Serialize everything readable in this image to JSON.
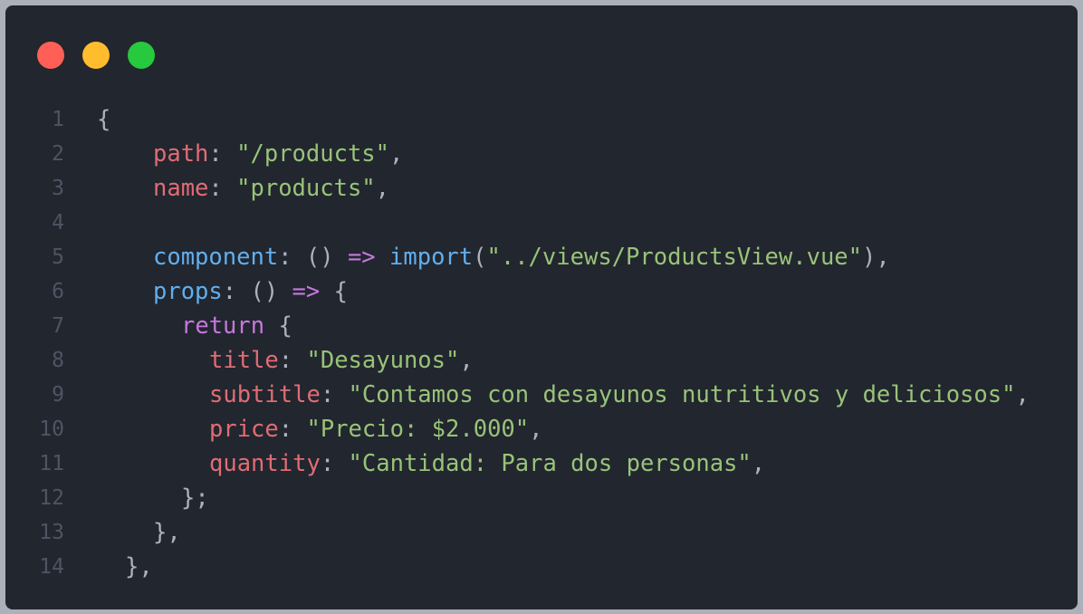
{
  "window": {
    "controls": [
      {
        "name": "close",
        "color": "#ff5f56"
      },
      {
        "name": "minimize",
        "color": "#ffbd2e"
      },
      {
        "name": "maximize",
        "color": "#27c93f"
      }
    ]
  },
  "colors": {
    "background": "#22262e",
    "line_number": "#4d5564",
    "punctuation": "#abb2bf",
    "property": "#e06c75",
    "function": "#61afef",
    "string": "#98c379",
    "keyword": "#c678dd"
  },
  "code": {
    "lines": [
      {
        "n": "1",
        "indent": "",
        "tokens": [
          {
            "t": "{",
            "c": "punct"
          }
        ]
      },
      {
        "n": "2",
        "indent": "  ",
        "tokens": [
          {
            "t": "path",
            "c": "key"
          },
          {
            "t": ": ",
            "c": "punct"
          },
          {
            "t": "\"/products\"",
            "c": "str"
          },
          {
            "t": ",",
            "c": "punct"
          }
        ]
      },
      {
        "n": "3",
        "indent": "  ",
        "tokens": [
          {
            "t": "name",
            "c": "key"
          },
          {
            "t": ": ",
            "c": "punct"
          },
          {
            "t": "\"products\"",
            "c": "str"
          },
          {
            "t": ",",
            "c": "punct"
          }
        ]
      },
      {
        "n": "4",
        "indent": "",
        "tokens": []
      },
      {
        "n": "5",
        "indent": "  ",
        "tokens": [
          {
            "t": "component",
            "c": "fn"
          },
          {
            "t": ": () ",
            "c": "punct"
          },
          {
            "t": "=>",
            "c": "kw"
          },
          {
            "t": " ",
            "c": "punct"
          },
          {
            "t": "import",
            "c": "fn"
          },
          {
            "t": "(",
            "c": "punct"
          },
          {
            "t": "\"../views/ProductsView.vue\"",
            "c": "str"
          },
          {
            "t": "),",
            "c": "punct"
          }
        ]
      },
      {
        "n": "6",
        "indent": "  ",
        "tokens": [
          {
            "t": "props",
            "c": "fn"
          },
          {
            "t": ": () ",
            "c": "punct"
          },
          {
            "t": "=>",
            "c": "kw"
          },
          {
            "t": " {",
            "c": "punct"
          }
        ]
      },
      {
        "n": "7",
        "indent": "   ",
        "tokens": [
          {
            "t": "return",
            "c": "kw"
          },
          {
            "t": " {",
            "c": "punct"
          }
        ]
      },
      {
        "n": "8",
        "indent": "    ",
        "tokens": [
          {
            "t": "title",
            "c": "key"
          },
          {
            "t": ": ",
            "c": "punct"
          },
          {
            "t": "\"Desayunos\"",
            "c": "str"
          },
          {
            "t": ",",
            "c": "punct"
          }
        ]
      },
      {
        "n": "9",
        "indent": "    ",
        "tokens": [
          {
            "t": "subtitle",
            "c": "key"
          },
          {
            "t": ": ",
            "c": "punct"
          },
          {
            "t": "\"Contamos con desayunos nutritivos y deliciosos\"",
            "c": "str"
          },
          {
            "t": ",",
            "c": "punct"
          }
        ]
      },
      {
        "n": "10",
        "indent": "    ",
        "tokens": [
          {
            "t": "price",
            "c": "key"
          },
          {
            "t": ": ",
            "c": "punct"
          },
          {
            "t": "\"Precio: $2.000\"",
            "c": "str"
          },
          {
            "t": ",",
            "c": "punct"
          }
        ]
      },
      {
        "n": "11",
        "indent": "    ",
        "tokens": [
          {
            "t": "quantity",
            "c": "key"
          },
          {
            "t": ": ",
            "c": "punct"
          },
          {
            "t": "\"Cantidad: Para dos personas\"",
            "c": "str"
          },
          {
            "t": ",",
            "c": "punct"
          }
        ]
      },
      {
        "n": "12",
        "indent": "   ",
        "tokens": [
          {
            "t": "};",
            "c": "punct"
          }
        ]
      },
      {
        "n": "13",
        "indent": "  ",
        "tokens": [
          {
            "t": "},",
            "c": "punct"
          }
        ]
      },
      {
        "n": "14",
        "indent": " ",
        "tokens": [
          {
            "t": "},",
            "c": "punct"
          }
        ]
      }
    ]
  }
}
